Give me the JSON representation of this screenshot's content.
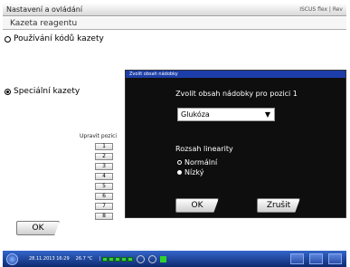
{
  "window": {
    "title": "Nastavení a ovládání",
    "brand": "ISCUS flex | Rev"
  },
  "header": {
    "subtitle": "Kazeta reagentu"
  },
  "options": {
    "code_cassettes": "Používání kódů kazety",
    "special_cassettes": "Speciální kazety"
  },
  "positions": {
    "label": "Upravit pozici",
    "buttons": [
      "1",
      "2",
      "3",
      "4",
      "5",
      "6",
      "7",
      "8"
    ]
  },
  "ok_button": "OK",
  "dialog": {
    "title": "Zvolit obsah nádobky",
    "heading": "Zvolit obsah nádobky pro pozici 1",
    "selected_value": "Glukóza",
    "dropdown_arrow": "▼",
    "linearity_label": "Rozsah linearity",
    "linearity_options": [
      {
        "label": "Normální",
        "selected": false
      },
      {
        "label": "Nízký",
        "selected": true
      }
    ],
    "ok": "OK",
    "cancel": "Zrušit"
  },
  "taskbar": {
    "date": "28.11.2013 16:29",
    "temperature": "26.7 °C",
    "separator": "|"
  },
  "colors": {
    "dialog_bg": "#0e0e0e",
    "dialog_title_bg": "#1d3ea8",
    "taskbar": "#1f4aa8"
  }
}
